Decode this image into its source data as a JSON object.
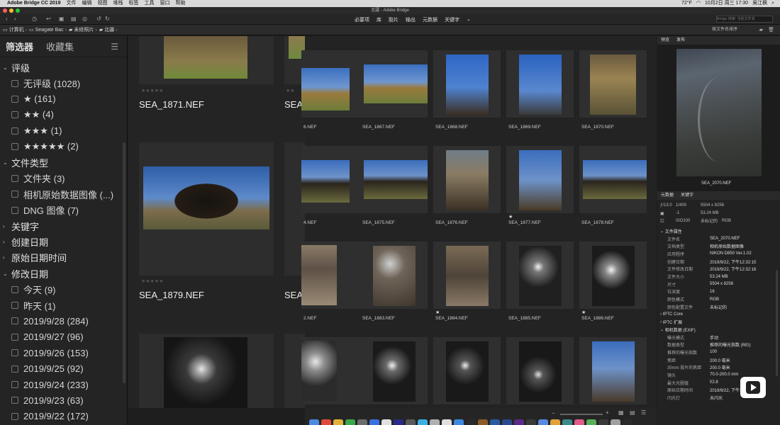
{
  "menubar": {
    "app_name": "Adobe Bridge CC 2019",
    "items": [
      "文件",
      "编辑",
      "视图",
      "堆栈",
      "标签",
      "工具",
      "窗口",
      "帮助"
    ],
    "right": [
      "72°F",
      "10月2日 周三 17:30",
      "吴江枫"
    ]
  },
  "window_title": "北疆 - Adobe Bridge",
  "workspaces": [
    "必要项",
    "库",
    "胶片",
    "输出",
    "元数据",
    "关键字"
  ],
  "search_placeholder": "Bridge 搜索: 当前文件夹",
  "path": [
    "计算机",
    "Seagate Bac",
    "未修照片",
    "北疆"
  ],
  "sort_label": "按文件名排序",
  "filter_panel": {
    "tabs": [
      "筛选器",
      "收藏集"
    ],
    "groups": [
      {
        "label": "评级",
        "expanded": true,
        "items": [
          "无评级 (1028)",
          "★ (161)",
          "★★ (4)",
          "★★★ (1)",
          "★★★★★ (2)"
        ]
      },
      {
        "label": "文件类型",
        "expanded": true,
        "items": [
          "文件夹 (3)",
          "相机原始数据图像 (...)",
          "DNG 图像 (7)"
        ]
      },
      {
        "label": "关键字",
        "expanded": false,
        "items": []
      },
      {
        "label": "创建日期",
        "expanded": false,
        "items": []
      },
      {
        "label": "原始日期时间",
        "expanded": false,
        "items": []
      },
      {
        "label": "修改日期",
        "expanded": true,
        "items": [
          "今天 (9)",
          "昨天 (1)",
          "2019/9/28 (284)",
          "2019/9/27 (96)",
          "2019/9/26 (153)",
          "2019/9/25 (92)",
          "2019/9/24 (233)",
          "2019/9/23 (63)",
          "2019/9/22 (172)"
        ]
      }
    ]
  },
  "large_thumbs": [
    "SEA_1871.NEF",
    "SEA_",
    "SEA_1879.NEF",
    "SEA_"
  ],
  "small_rows": [
    {
      "names": [
        "6.NEF",
        "SEA_1867.NEF",
        "SEA_1868.NEF",
        "SEA_1869.NEF",
        "SEA_1870.NEF"
      ],
      "stars": [
        "",
        "",
        "",
        "",
        ""
      ]
    },
    {
      "names": [
        "4.NEF",
        "SEA_1875.NEF",
        "SEA_1876.NEF",
        "SEA_1877.NEF",
        "SEA_1878.NEF"
      ],
      "stars": [
        "",
        "",
        "",
        "★",
        ""
      ]
    },
    {
      "names": [
        "2.NEF",
        "SEA_1883.NEF",
        "SEA_1884.NEF",
        "SEA_1885.NEF",
        "SEA_1886.NEF"
      ],
      "stars": [
        "",
        "",
        "★",
        "",
        "★"
      ]
    }
  ],
  "preview": {
    "tabs": [
      "预览",
      "发布"
    ],
    "filename": "SEA_2070.NEF"
  },
  "metadata": {
    "tabs": [
      "元数据",
      "关键字"
    ],
    "summary": [
      [
        "ƒ/13.0",
        "1/400",
        "5504 x 8256"
      ],
      [
        "",
        "-1",
        "53.24 MB"
      ],
      [
        "",
        "ISO100",
        "未标记的",
        "RGB"
      ]
    ],
    "file_props_title": "文件属性",
    "file_props": [
      [
        "文件名",
        "SEA_2070.NEF"
      ],
      [
        "文档类型",
        "相机原始数据图像"
      ],
      [
        "应用程序",
        "NIKON D850 Ver.1.02"
      ],
      [
        "创建日期",
        "2019/9/22, 下午12:32:15"
      ],
      [
        "文件修改日期",
        "2019/9/22, 下午12:32:16"
      ],
      [
        "文件大小",
        "53.24 MB"
      ],
      [
        "尺寸",
        "5504 x 8256"
      ],
      [
        "位深度",
        "16"
      ],
      [
        "颜色模式",
        "RGB"
      ],
      [
        "颜色配置文件",
        "未标记的"
      ]
    ],
    "iptc_core": "IPTC Core",
    "iptc_ext": "IPTC 扩展",
    "exif_title": "相机数据 (EXIF)",
    "exif": [
      [
        "曝光模式",
        "手动"
      ],
      [
        "数据类型",
        "推荐的曝光指数 (REI)"
      ],
      [
        "推荐的曝光指数",
        "100"
      ],
      [
        "焦距",
        "200.0 毫米"
      ],
      [
        "35mm 胶片的焦距",
        "200.0 毫米"
      ],
      [
        "镜头",
        "70.0-200.0 mm"
      ],
      [
        "最大光圈值",
        "f/2.8"
      ],
      [
        "原始日期时间",
        "2019/9/22, 下午12:32:15"
      ],
      [
        "闪光灯",
        "未闪光"
      ]
    ]
  },
  "colors": {
    "accent": "#3d7bd6",
    "bg": "#1e1e1e"
  }
}
